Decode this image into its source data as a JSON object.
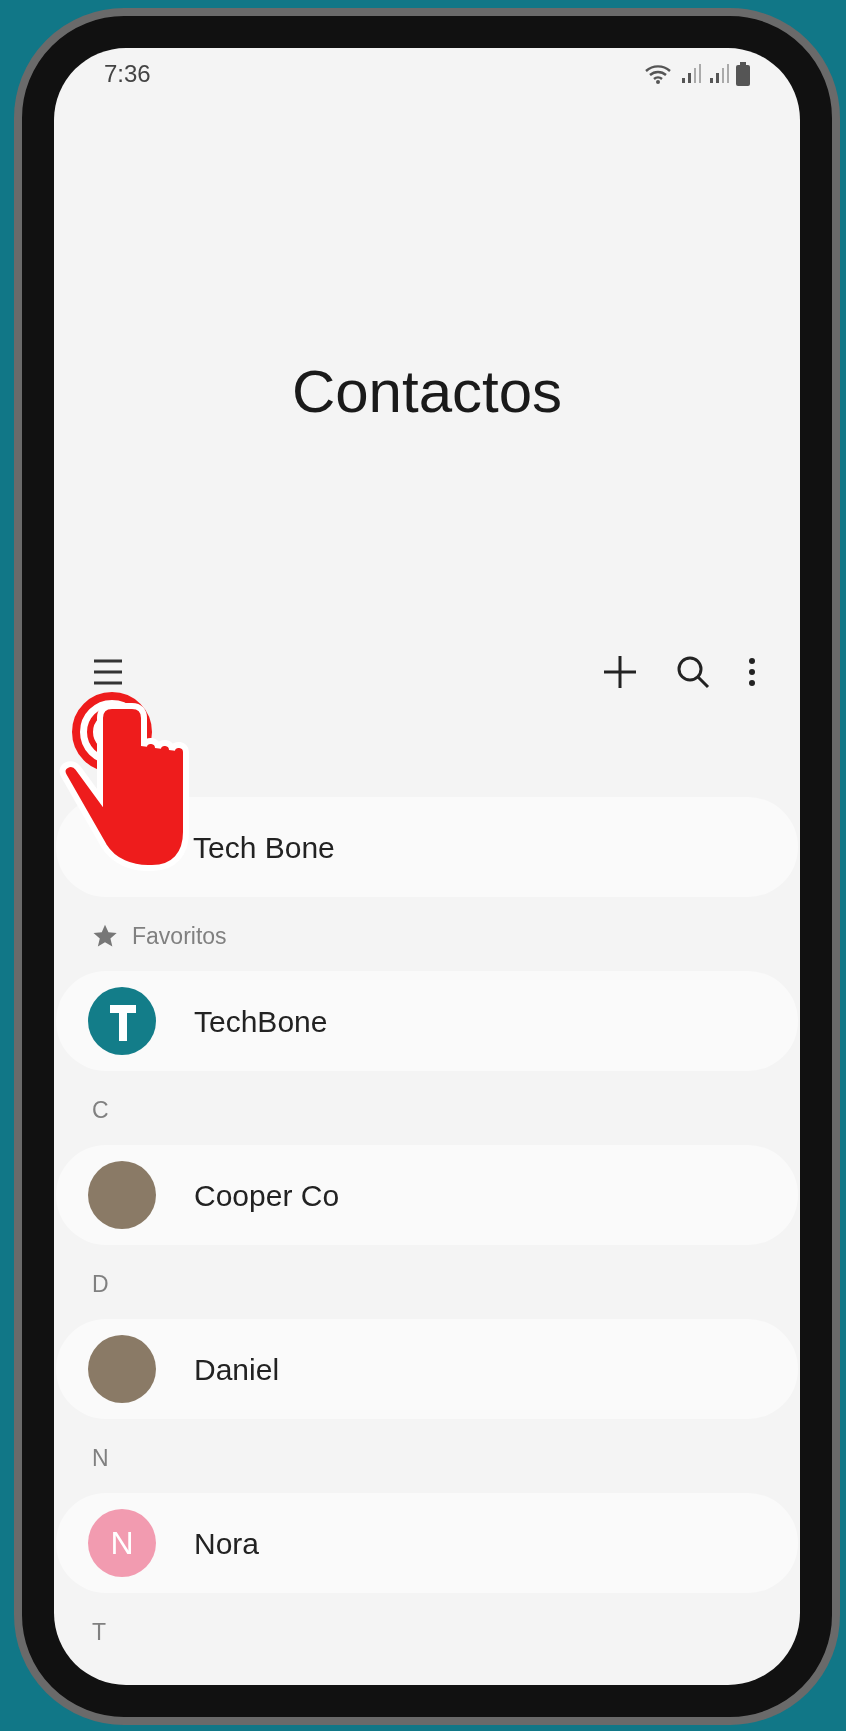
{
  "status_bar": {
    "time": "7:36"
  },
  "title": "Contactos",
  "profile": {
    "name": "Tech Bone"
  },
  "sections": [
    {
      "kind": "favorites",
      "header": "Favoritos",
      "contacts": [
        {
          "name": "TechBone",
          "kind": "logo"
        }
      ]
    },
    {
      "kind": "letter",
      "header": "C",
      "contacts": [
        {
          "name": "Cooper Co",
          "kind": "photo"
        }
      ]
    },
    {
      "kind": "letter",
      "header": "D",
      "contacts": [
        {
          "name": "Daniel",
          "kind": "photo"
        }
      ]
    },
    {
      "kind": "letter",
      "header": "N",
      "contacts": [
        {
          "name": "Nora",
          "kind": "initial",
          "initial": "N",
          "color": "#f29bb0"
        }
      ]
    },
    {
      "kind": "letter",
      "header": "T"
    }
  ]
}
